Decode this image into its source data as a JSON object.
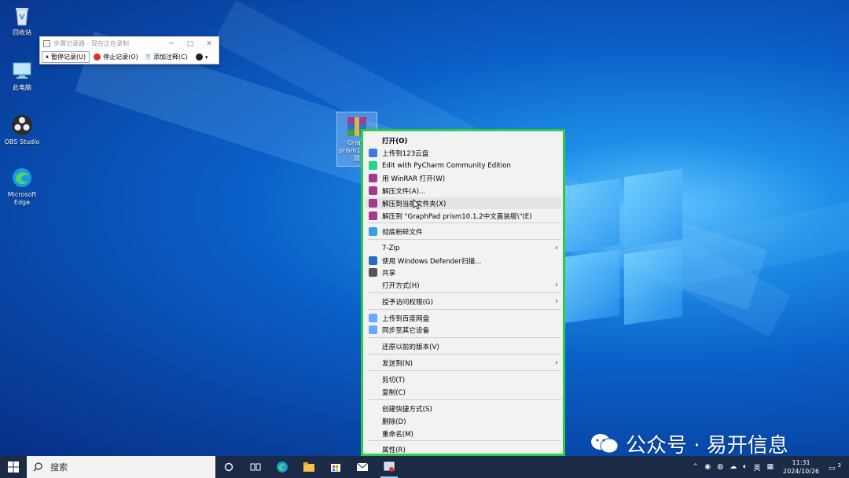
{
  "desktop_icons": [
    {
      "label": "回收站",
      "icon": "recycle-bin-icon"
    },
    {
      "label": "此电脑",
      "icon": "computer-icon"
    },
    {
      "label": "OBS Studio",
      "icon": "obs-icon"
    },
    {
      "label": "Microsoft Edge",
      "icon": "edge-icon"
    }
  ],
  "file_icon": {
    "label": "Graph prism1 中文版",
    "icon": "winrar-archive-icon"
  },
  "recorder": {
    "title": "步骤记录器 - 现在正在录制",
    "pause": "暂停记录(U)",
    "stop": "停止记录(O)",
    "comment": "添加注释(C)",
    "help_icon": "help-icon"
  },
  "context_menu": {
    "items": [
      {
        "label": "打开(O)",
        "icon": "none"
      },
      {
        "label": "上传到123云盘",
        "icon": "cloud-123-icon"
      },
      {
        "label": "Edit with PyCharm Community Edition",
        "icon": "pycharm-icon"
      },
      {
        "label": "用 WinRAR 打开(W)",
        "icon": "winrar-icon"
      },
      {
        "label": "解压文件(A)...",
        "icon": "winrar-icon"
      },
      {
        "label": "解压到当前文件夹(X)",
        "icon": "winrar-icon"
      },
      {
        "label": "解压到 \"GraphPad prism10.1.2中文直装版\\\"(E)",
        "icon": "winrar-icon"
      },
      {
        "label": "彻底粉碎文件",
        "icon": "shredder-icon"
      },
      {
        "label": "7-Zip",
        "icon": "none"
      },
      {
        "label": "使用 Windows Defender扫描...",
        "icon": "defender-icon"
      },
      {
        "label": "共享",
        "icon": "share-icon"
      },
      {
        "label": "打开方式(H)",
        "icon": "none"
      },
      {
        "label": "授予访问权限(G)",
        "icon": "none"
      },
      {
        "label": "上传到百度网盘",
        "icon": "baidu-icon"
      },
      {
        "label": "同步至其它设备",
        "icon": "baidu-icon"
      },
      {
        "label": "还原以前的版本(V)",
        "icon": "none"
      },
      {
        "label": "发送到(N)",
        "icon": "none"
      },
      {
        "label": "剪切(T)",
        "icon": "none"
      },
      {
        "label": "复制(C)",
        "icon": "none"
      },
      {
        "label": "创建快捷方式(S)",
        "icon": "none"
      },
      {
        "label": "删除(D)",
        "icon": "none"
      },
      {
        "label": "重命名(M)",
        "icon": "none"
      },
      {
        "label": "属性(R)",
        "icon": "none"
      }
    ]
  },
  "watermark": {
    "text": "公众号 · 易开信息"
  },
  "taskbar": {
    "search_placeholder": "搜索",
    "tray_ime": "英",
    "time": "11:31",
    "date": "2024/10/26",
    "notifications": "3"
  },
  "colors": {
    "menu_highlight_border": "#2ecc40",
    "taskbar": "#1b2b45",
    "accent": "#0078d7"
  }
}
